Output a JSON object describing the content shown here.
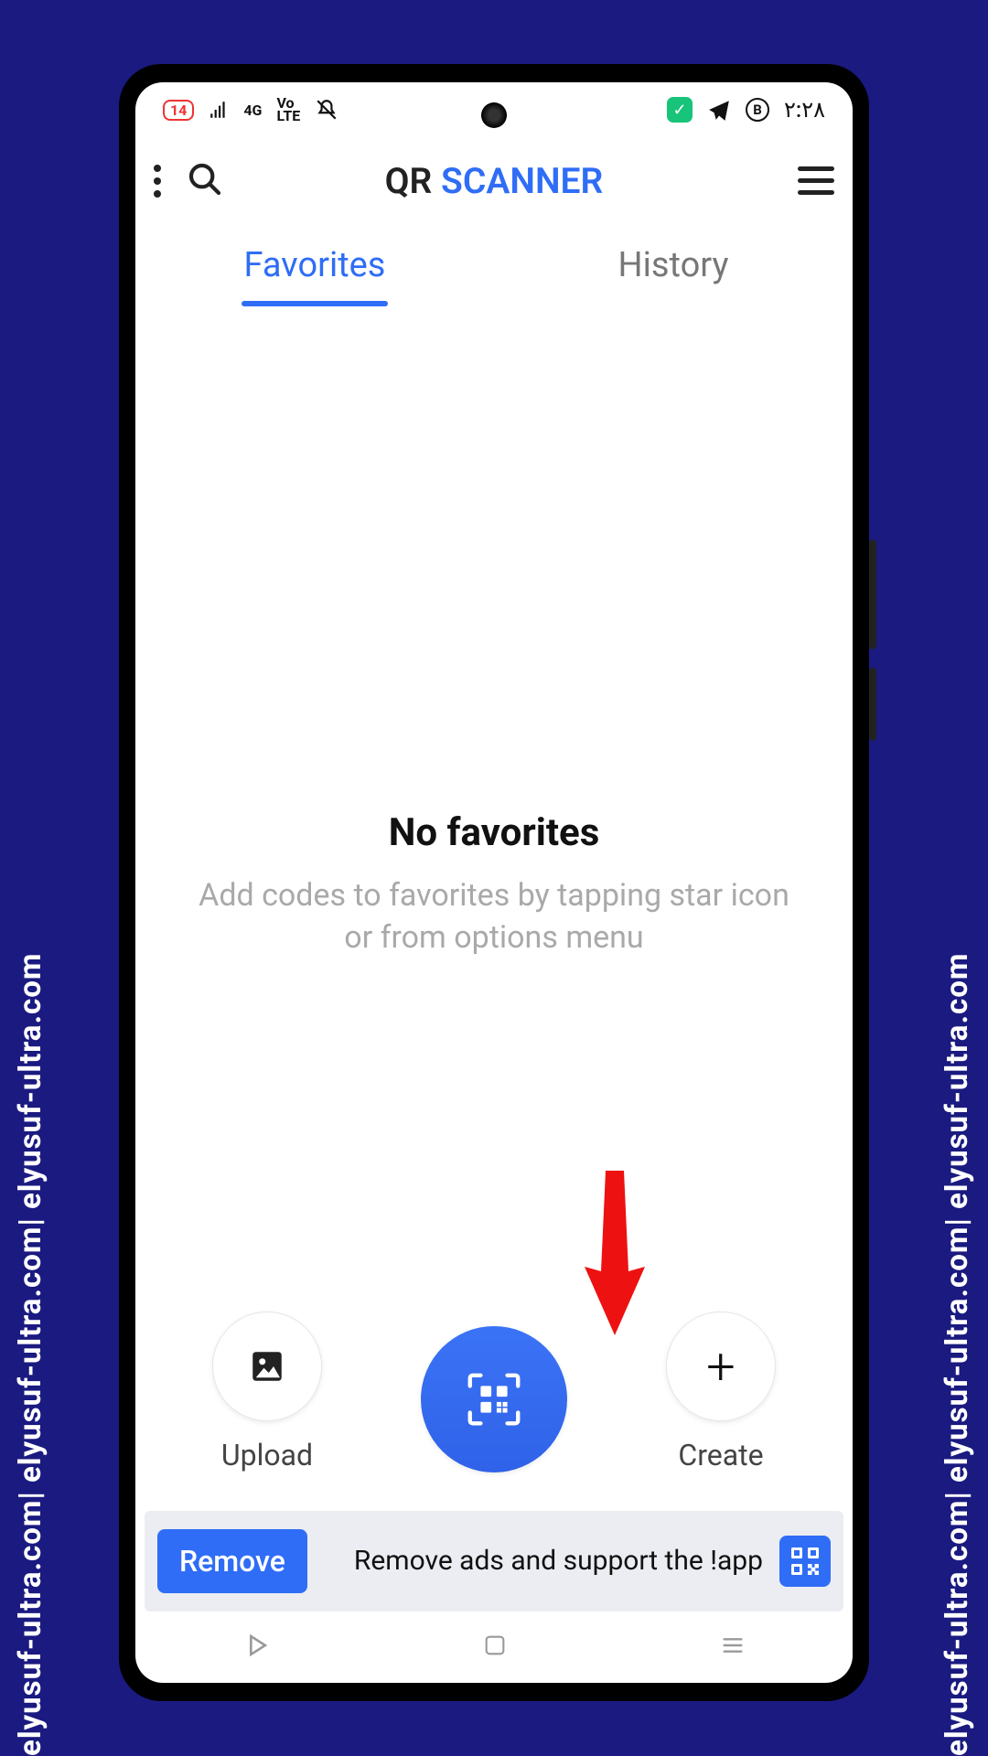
{
  "watermark_text": "elyusuf-ultra.com| elyusuf-ultra.com| elyusuf-ultra.com",
  "status": {
    "battery_label": "14",
    "signal": "4G",
    "volte": "Vo\nLTE",
    "time": "٢:٢٨",
    "badge_letter": "B"
  },
  "header": {
    "title_part1": "QR ",
    "title_part2": "SCANNER"
  },
  "tabs": {
    "favorites": "Favorites",
    "history": "History"
  },
  "empty": {
    "title": "No favorites",
    "subtitle": "Add codes to favorites by tapping star icon or from options menu"
  },
  "actions": {
    "upload": "Upload",
    "create": "Create"
  },
  "banner": {
    "button": "Remove",
    "text": "Remove ads and support the !app"
  }
}
